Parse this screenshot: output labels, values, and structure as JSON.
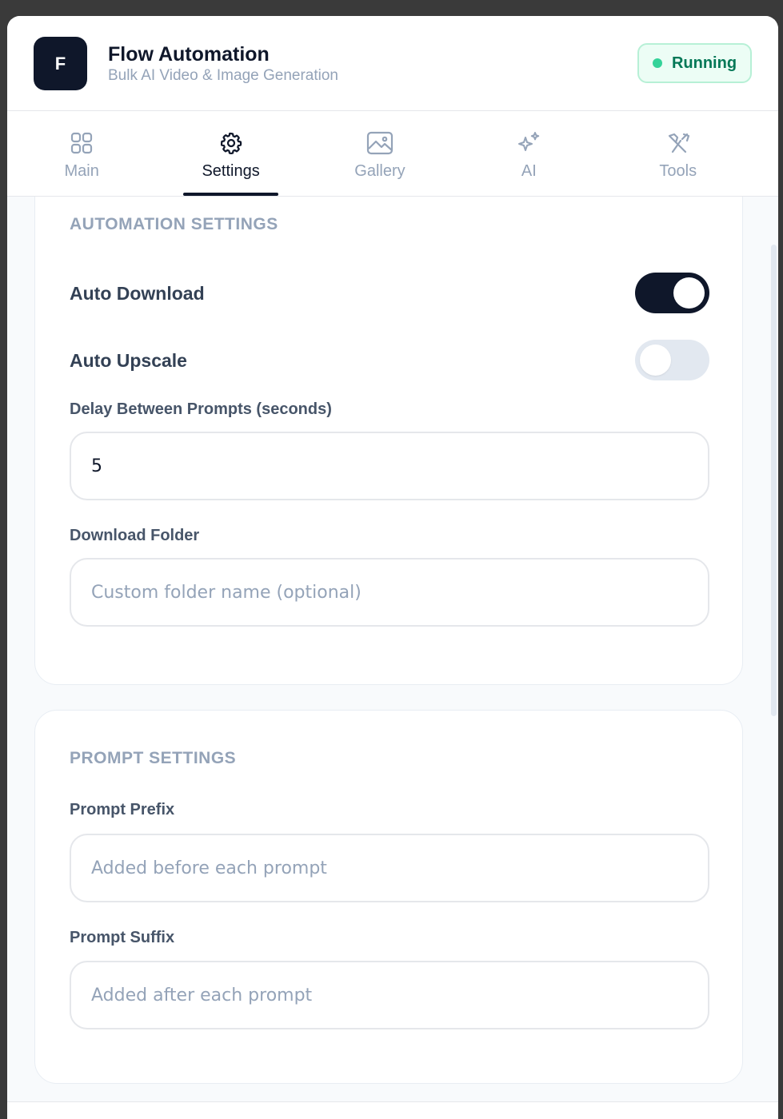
{
  "header": {
    "logo_letter": "F",
    "title": "Flow Automation",
    "subtitle": "Bulk AI Video & Image Generation",
    "status": "Running"
  },
  "tabs": [
    {
      "label": "Main",
      "icon": "grid-icon"
    },
    {
      "label": "Settings",
      "icon": "gear-icon",
      "active": true
    },
    {
      "label": "Gallery",
      "icon": "image-icon"
    },
    {
      "label": "AI",
      "icon": "sparkles-icon"
    },
    {
      "label": "Tools",
      "icon": "tools-icon"
    }
  ],
  "automation": {
    "section_title": "AUTOMATION SETTINGS",
    "auto_download_label": "Auto Download",
    "auto_download_on": true,
    "auto_upscale_label": "Auto Upscale",
    "auto_upscale_on": false,
    "delay_label": "Delay Between Prompts (seconds)",
    "delay_value": "5",
    "folder_label": "Download Folder",
    "folder_placeholder": "Custom folder name (optional)"
  },
  "prompt": {
    "section_title": "PROMPT SETTINGS",
    "prefix_label": "Prompt Prefix",
    "prefix_placeholder": "Added before each prompt",
    "suffix_label": "Prompt Suffix",
    "suffix_placeholder": "Added after each prompt"
  },
  "colors": {
    "primary": "#0f172a",
    "muted": "#94a3b8",
    "status_bg": "#ecfdf5",
    "status_text": "#047857",
    "status_dot": "#34d399"
  }
}
